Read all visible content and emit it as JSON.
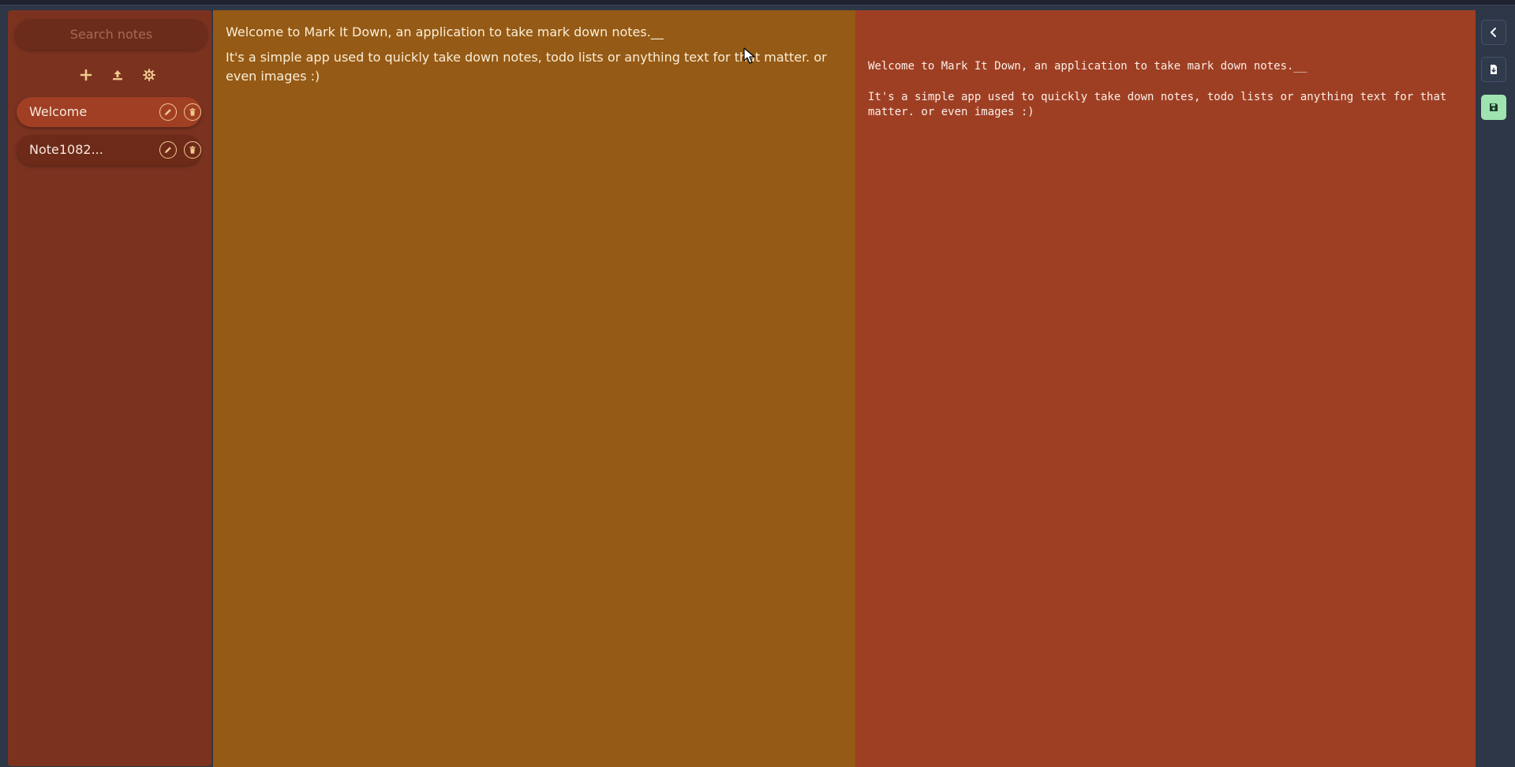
{
  "app": {
    "colors": {
      "sidebar_bg": "#7b3320",
      "editor_bg": "#955a15",
      "preview_bg": "#9e3f24",
      "note_active_bg": "#a13f24",
      "icon_accent": "#f2c98e",
      "save_accent": "#9fe3b0"
    }
  },
  "sidebar": {
    "search_placeholder": "Search notes",
    "tools": [
      {
        "name": "add-note",
        "icon": "plus-icon"
      },
      {
        "name": "upload-note",
        "icon": "upload-icon"
      },
      {
        "name": "settings",
        "icon": "gear-icon"
      }
    ],
    "notes": [
      {
        "label": "Welcome",
        "active": true
      },
      {
        "label": "Note1082...",
        "active": false
      }
    ]
  },
  "editor": {
    "paragraphs": [
      "Welcome to Mark It Down, an application to take mark down notes.__",
      "It's a simple app used to quickly take down notes, todo lists or anything text for that matter. or even images :)"
    ]
  },
  "preview": {
    "paragraphs": [
      "Welcome to Mark It Down, an application to take mark down notes.__",
      "It's a simple app used to quickly take down notes, todo lists or anything text for that matter. or even images :)"
    ]
  },
  "rightbar": {
    "buttons": [
      {
        "name": "collapse",
        "icon": "chevron-left-icon"
      },
      {
        "name": "export",
        "icon": "file-download-icon"
      },
      {
        "name": "save",
        "icon": "floppy-disk-icon"
      }
    ]
  }
}
